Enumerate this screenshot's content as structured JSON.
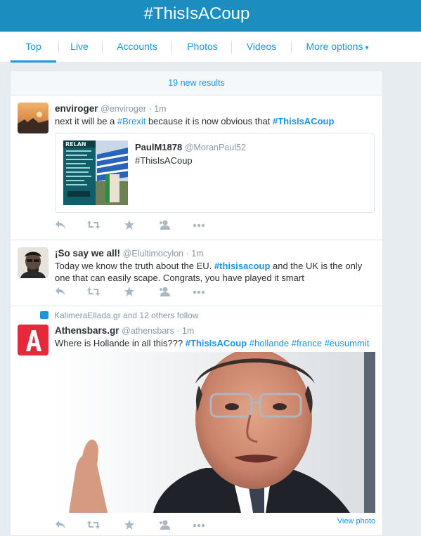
{
  "header": {
    "title": "#ThisIsACoup"
  },
  "tabs": [
    {
      "label": "Top"
    },
    {
      "label": "Live"
    },
    {
      "label": "Accounts"
    },
    {
      "label": "Photos"
    },
    {
      "label": "Videos"
    },
    {
      "label": "More options"
    }
  ],
  "stream": {
    "new_results": "19 new results"
  },
  "tweets": [
    {
      "name": "enviroger",
      "handle": "@enviroger",
      "time": "· 1m",
      "text_parts": [
        "next it will be a ",
        "#Brexit",
        " because it is now obvious that ",
        "#ThisIsACoup"
      ],
      "quote": {
        "name": "PaulM1878",
        "handle": "@MoranPaul52",
        "text": "#ThisIsACoup"
      }
    },
    {
      "name": "¡So say we all!",
      "handle": "@Elultimocylon",
      "time": "· 1m",
      "text_parts": [
        "Today we know the truth about the EU. ",
        "#thisisacoup",
        " and the UK is the only one that can easily scape. Congrats, you have played it smart"
      ]
    },
    {
      "context": "KalimeraEllada.gr and 12 others follow",
      "name": "Athensbars.gr",
      "handle": "@athensbars",
      "time": "· 1m",
      "avatar_letter": "A",
      "text_parts": [
        "Where is Hollande in all this??? ",
        "#ThisIsACoup",
        " ",
        "#hollande",
        " ",
        "#france",
        " ",
        "#eusummit"
      ],
      "view_photo": "View photo"
    }
  ],
  "colors": {
    "brand": "#1b8ebf",
    "link": "#1b95e0",
    "muted": "#8899a6"
  }
}
